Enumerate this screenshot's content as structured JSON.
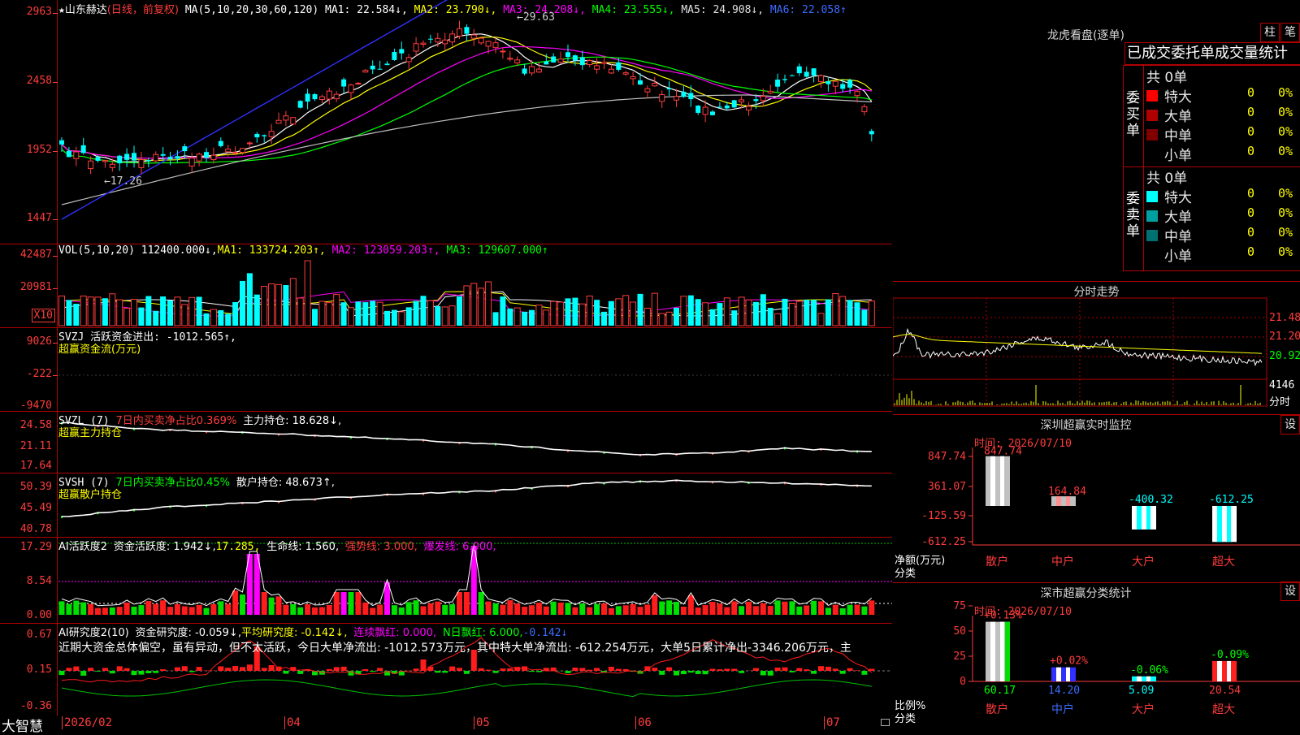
{
  "kline": {
    "title_star": "★",
    "stock": "山东赫达",
    "mode": "(日线，前复权)",
    "ma_label": "MA(5,10,20,30,60,120)",
    "ma1": "MA1: 22.584↓,",
    "ma2": "MA2: 23.790↓,",
    "ma3": "MA3: 24.208↓,",
    "ma4": "MA4: 23.555↓,",
    "ma5": "MA5: 24.908↓,",
    "ma6": "MA6: 22.058↑",
    "y_labels": [
      "2963",
      "2458",
      "1952",
      "1447"
    ],
    "high_mark": "29.63",
    "low_mark": "17.26",
    "colors": {
      "up": "#ff3c3c",
      "down": "#00ffff",
      "ma1": "#ffffff",
      "ma2": "#ffff00",
      "ma3": "#ff00ff",
      "ma4": "#00ff00",
      "ma5": "#c0c0c0",
      "ma6": "#3030ff"
    }
  },
  "vol": {
    "label": "VOL(5,10,20)",
    "value": "112400.000↓,",
    "ma1": "MA1: 133724.203↑,",
    "ma2": "MA2: 123059.203↑,",
    "ma3": "MA3: 129607.000↑",
    "y_labels": [
      "42487",
      "20981"
    ],
    "unit": "X10"
  },
  "svzj": {
    "label": "SVZJ",
    "value": "活跃资金进出: -1012.565↑,",
    "subtitle": "超赢资金流(万元)",
    "y_labels": [
      "9026",
      "-222",
      "-9470"
    ]
  },
  "svzl": {
    "label": "SVZL (7)",
    "ratio": "7日内买卖净占比0.369%",
    "value": "主力持仓: 18.628↓,",
    "subtitle": "超赢主力持仓",
    "y_labels": [
      "24.58",
      "21.11",
      "17.64"
    ]
  },
  "svsh": {
    "label": "SVSH (7)",
    "ratio": "7日内买卖净占比0.45%",
    "value": "散户持仓: 48.673↑,",
    "subtitle": "超赢散户持仓",
    "y_labels": [
      "50.39",
      "45.49",
      "40.78"
    ]
  },
  "ai_active": {
    "label": "AI活跃度2",
    "v1": "资金活跃度: 1.942↓,",
    "v2": "17.285,",
    "v3": "生命线: 1.560,",
    "v4": "强势线: 3.000,",
    "v5": "爆发线: 6.000,",
    "y_labels": [
      "17.29",
      "8.54",
      "0.00"
    ]
  },
  "ai_research": {
    "label": "AI研究度2(10)",
    "v1": "资金研究度: -0.059↓,",
    "v2": "平均研究度: -0.142↓,",
    "v3": "连续飘红: 0.000,",
    "v4": "N日飘红: 6.000,",
    "v5": "-0.142↓",
    "comment": "近期大资金总体偏空，虽有异动，但不太活跃，今日大单净流出: -1012.573万元，其中特大单净流出: -612.254万元，大单5日累计净出-3346.206万元，主",
    "y_labels": [
      "0.67",
      "0.15",
      "-0.36"
    ]
  },
  "bottom": {
    "brand": "大智慧",
    "dates": [
      "2026/02",
      "04",
      "05",
      "06",
      "07"
    ]
  },
  "dragon": {
    "title": "龙虎看盘(逐单)",
    "btn1": "柱",
    "btn2": "笔",
    "header": "已成交委托单成交量统计",
    "buy_label": "委买单",
    "sell_label": "委卖单",
    "buy_total": "共 0单",
    "sell_total": "共 0单",
    "rows": [
      {
        "name": "特大",
        "v": "0",
        "p": "0%"
      },
      {
        "name": "大单",
        "v": "0",
        "p": "0%"
      },
      {
        "name": "中单",
        "v": "0",
        "p": "0%"
      },
      {
        "name": "小单",
        "v": "0",
        "p": "0%"
      }
    ],
    "buy_colors": [
      "#ff0000",
      "#b00000",
      "#800000"
    ],
    "sell_colors": [
      "#00ffff",
      "#00a0a0",
      "#007070"
    ]
  },
  "intraday": {
    "title": "分时走势",
    "y_labels": [
      "21.48",
      "21.20",
      "20.92"
    ],
    "vol_label": "4146",
    "unit": "分时"
  },
  "sz_monitor": {
    "title": "深圳超赢实时监控",
    "btn": "设",
    "time": "时间: 2026/07/10",
    "y_labels": [
      "847.74",
      "361.07",
      "-125.59",
      "-612.25"
    ],
    "values": [
      847.74,
      164.84,
      -400.32,
      -612.25
    ],
    "value_labels": [
      "847.74",
      "164.84",
      "-400.32",
      "-612.25"
    ],
    "categories": [
      "散户",
      "中户",
      "大户",
      "超大"
    ],
    "axis_note1": "净额(万元)",
    "axis_note2": "分类"
  },
  "sz_stats": {
    "title": "深市超赢分类统计",
    "btn": "设",
    "time": "时间: 2026/07/10",
    "y_labels": [
      "75",
      "50",
      "25",
      "0"
    ],
    "values": [
      60.17,
      14.2,
      5.09,
      20.54
    ],
    "value_labels": [
      "60.17",
      "14.20",
      "5.09",
      "20.54"
    ],
    "top_labels": [
      "+0.13%",
      "+0.02%",
      "-0.06%",
      "-0.09%"
    ],
    "categories": [
      "散户",
      "中户",
      "大户",
      "超大"
    ],
    "axis_note1": "比例%",
    "axis_note2": "分类"
  }
}
